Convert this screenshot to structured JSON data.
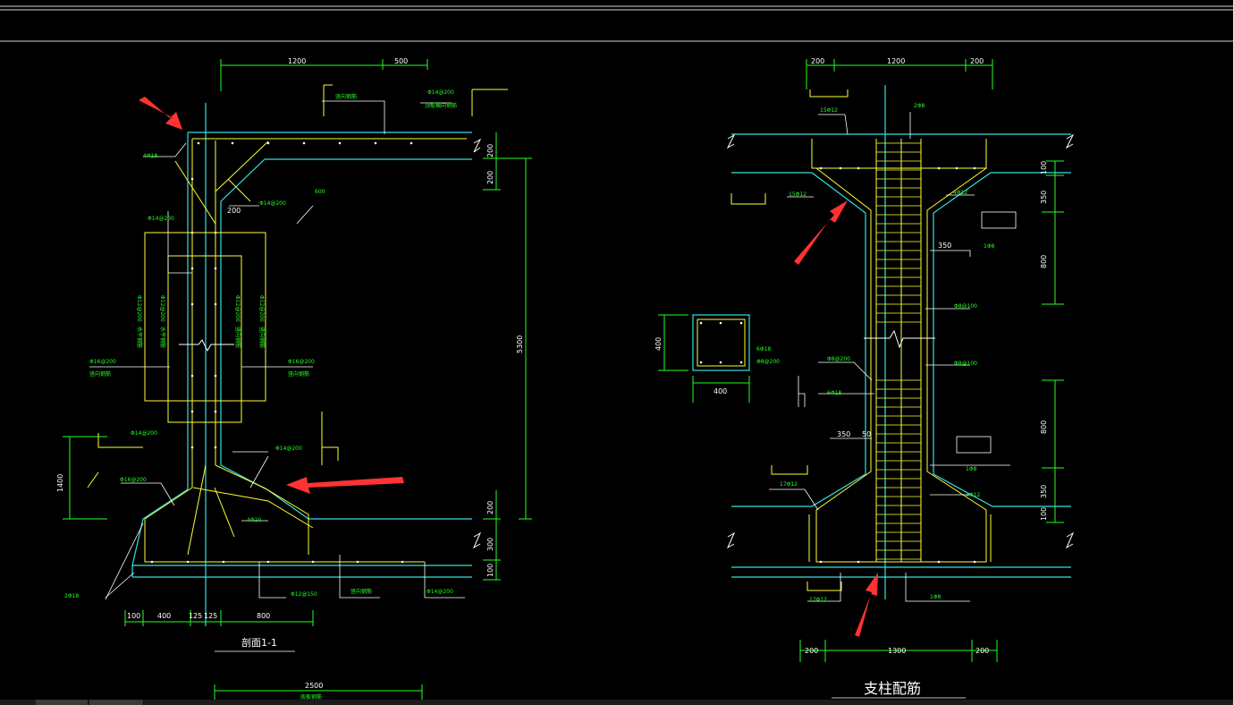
{
  "drawing": {
    "section_title": "剖面1-1",
    "column_title": "支柱配筋"
  },
  "left_section": {
    "dimensions": [
      "1200",
      "500",
      "200",
      "200",
      "5300",
      "1400",
      "200",
      "300",
      "100",
      "100",
      "400",
      "125",
      "125",
      "800",
      "2500",
      "200",
      "600"
    ],
    "labels": {
      "dim_1200": "1200",
      "dim_500": "500",
      "dim_200_r1": "200",
      "dim_200_r2": "200",
      "dim_5300": "5300",
      "dim_1400": "1400",
      "dim_200_r3": "200",
      "dim_300": "300",
      "dim_100_r": "100",
      "dim_100_b": "100",
      "dim_400_b": "400",
      "dim_125_a": "125",
      "dim_125_b": "125",
      "dim_800_b": "800",
      "dim_2500": "2500",
      "dim_200_in": "200",
      "dim_600": "600",
      "rebar_top_1": "竖向钢筋",
      "rebar_top_2": "Φ14@200",
      "rebar_top_3": "顶板横向钢筋",
      "rebar_4d18": "4Φ18",
      "rebar_phi14_200_a": "Φ14@200",
      "rebar_phi14_200_b": "Φ14@200",
      "rebar_phi16_200_l": "Φ16@200",
      "rebar_vert_l": "竖向钢筋",
      "rebar_phi16_200_r": "Φ16@200",
      "rebar_vert_r": "竖向钢筋",
      "rebar_phi14_200_c": "Φ14@200",
      "rebar_phi16_200_d": "Φ16@200",
      "rebar_phi14_200_e": "Φ14@200",
      "rebar_4d20": "4Φ20",
      "rebar_2d18": "2Φ18",
      "rebar_phi12_150": "Φ12@150",
      "rebar_bottom_v": "竖向钢筋",
      "rebar_phi14_200_f": "Φ14@200",
      "rebar_bot_len": "底板钢筋",
      "v_lab_1": "Φ12@200",
      "v_lab_2": "Φ12@200",
      "v_lab_3": "水平钢筋",
      "v_lab_4": "水平钢筋",
      "v_lab_5": "Φ12@200",
      "v_lab_6": "Φ12@200",
      "v_lab_7": "竖向钢筋",
      "v_lab_8": "竖向钢筋"
    }
  },
  "right_section": {
    "labels": {
      "dim_200_a": "200",
      "dim_1200": "1200",
      "dim_200_b": "200",
      "rebar_15d12_a": "15Φ12",
      "rebar_2d8": "2Φ8",
      "rebar_15d12_b": "15Φ12",
      "rebar_4d12_a": "4Φ12",
      "dim_350_a": "350",
      "rebar_1d8_a": "1Φ8",
      "dim_100_a": "100",
      "dim_350_v": "350",
      "dim_800_a": "800",
      "rebar_phi8_100_a": "Φ8@100",
      "dim_400_v": "400",
      "dim_400_h": "400",
      "rebar_6d18": "6Φ18",
      "rebar_phi8_200_a": "Φ8@200",
      "rebar_phi8_200_b": "Φ8@200",
      "rebar_phi8_100_b": "Φ8@100",
      "rebar_6d18_b": "6Φ18",
      "dim_350_b": "350",
      "dim_50": "50",
      "dim_800_b": "800",
      "rebar_1d8_b": "1Φ8",
      "rebar_17d12_a": "17Φ12",
      "rebar_4d12_b": "4Φ12",
      "dim_350_v2": "350",
      "dim_100_b": "100",
      "rebar_17d12_b": "17Φ12",
      "rebar_1d8_c": "1Φ8",
      "dim_200_c": "200",
      "dim_1300": "1300",
      "dim_200_d": "200"
    }
  },
  "colors": {
    "background": "#000000",
    "white": "#ffffff",
    "cyan": "#33e0e0",
    "yellow": "#ffff33",
    "green": "#22ff22",
    "red": "#ff3333"
  },
  "tabs": [
    "",
    "",
    "",
    ""
  ]
}
